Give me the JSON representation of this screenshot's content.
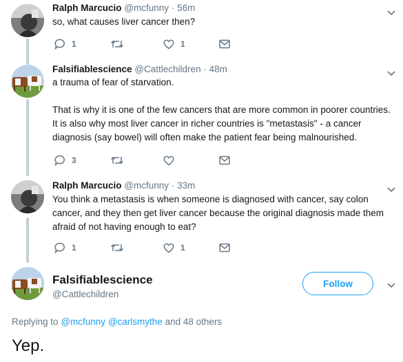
{
  "tweets": [
    {
      "name": "Ralph Marcucio",
      "handle": "@mcfunny",
      "time": "56m",
      "paragraphs": [
        "so, what causes liver cancer then?"
      ],
      "replies": "1",
      "retweets": "",
      "likes": "1"
    },
    {
      "name": "Falsifiablescience",
      "handle": "@Cattlechildren",
      "time": "48m",
      "paragraphs": [
        "a trauma of fear of starvation.",
        "That is why it is one of the few cancers that are more common in poorer countries. It is also why most liver cancer in richer countries is \"metastasis\" - a cancer diagnosis (say bowel) will often make the patient fear being malnourished."
      ],
      "replies": "3",
      "retweets": "",
      "likes": ""
    },
    {
      "name": "Ralph Marcucio",
      "handle": "@mcfunny",
      "time": "33m",
      "paragraphs": [
        "You think a metastasis is when someone is diagnosed with cancer, say colon cancer, and they then get liver cancer because the original diagnosis made them afraid of not having enough to eat?"
      ],
      "replies": "1",
      "retweets": "",
      "likes": "1"
    }
  ],
  "main": {
    "name": "Falsifiablescience",
    "handle": "@Cattlechildren",
    "follow_label": "Follow",
    "replying_prefix": "Replying to",
    "replying_user1": "@mcfunny",
    "replying_user2": "@carlsmythe",
    "replying_suffix": "and 48 others",
    "text": "Yep."
  },
  "colors": {
    "accent": "#1da1f2",
    "muted": "#657786",
    "text": "#14171a",
    "thread_line": "#c4cfd6"
  },
  "icons": [
    "reply-icon",
    "retweet-icon",
    "like-icon",
    "message-icon",
    "chevron-down-icon"
  ]
}
